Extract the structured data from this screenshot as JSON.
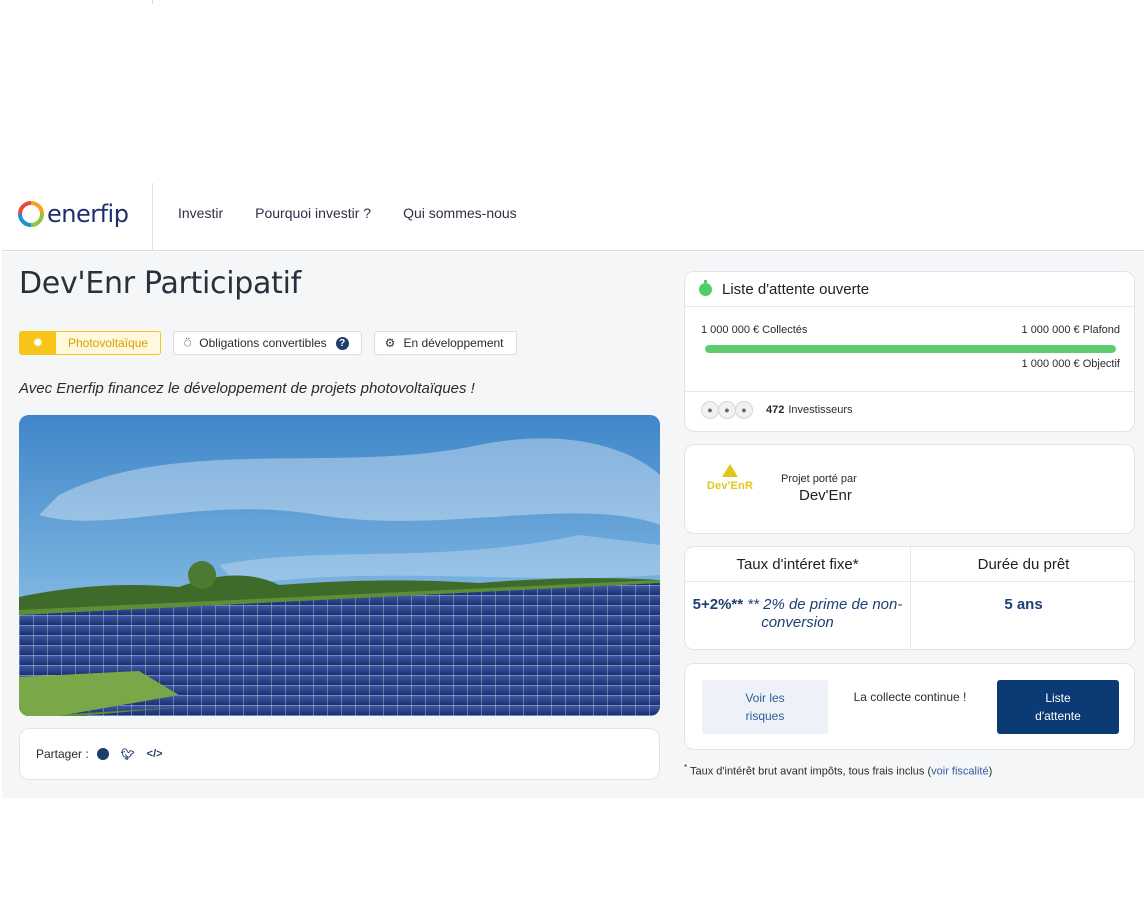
{
  "header": {
    "logo_text": "enerfip",
    "nav": [
      "Investir",
      "Pourquoi investir ?",
      "Qui sommes-nous"
    ]
  },
  "project": {
    "title": "Dev'Enr Participatif",
    "tags": [
      {
        "label": "Photovoltaïque",
        "icon": "sun-icon"
      },
      {
        "label": "Obligations convertibles",
        "icon": "award-icon"
      },
      {
        "label": "En développement",
        "icon": "gears-icon"
      }
    ],
    "lead": "Avec Enerfip financez le développement de projets photovoltaïques !",
    "share_label": "Partager :"
  },
  "status": {
    "title": "Liste d'attente ouverte",
    "collected": "1 000 000 € Collectés",
    "cap": "1 000 000 € Plafond",
    "goal": "1 000 000 € Objectif",
    "progress_percent": 100,
    "investors_count": "472",
    "investors_label": "Investisseurs"
  },
  "carrier": {
    "label": "Projet porté par",
    "name": "Dev'Enr",
    "logo_text": "Dev'EnR"
  },
  "terms": {
    "rate_header": "Taux d'intéret fixe*",
    "rate_value": "5+2%**",
    "rate_note": "** 2% de prime de non-conversion",
    "duration_header": "Durée du prêt",
    "duration_value": "5 ans"
  },
  "actions": {
    "risks": "Voir les risques",
    "continue": "La collecte continue !",
    "waitlist": "Liste d'attente"
  },
  "footnote": {
    "text": "Taux d'intérêt brut avant impôts, tous frais inclus (",
    "link": "voir fiscalité",
    "end": ")"
  },
  "colors": {
    "brand_navy": "#0c3a75",
    "progress_green": "#5ccc6e",
    "pv_yellow": "#f7c51a"
  }
}
